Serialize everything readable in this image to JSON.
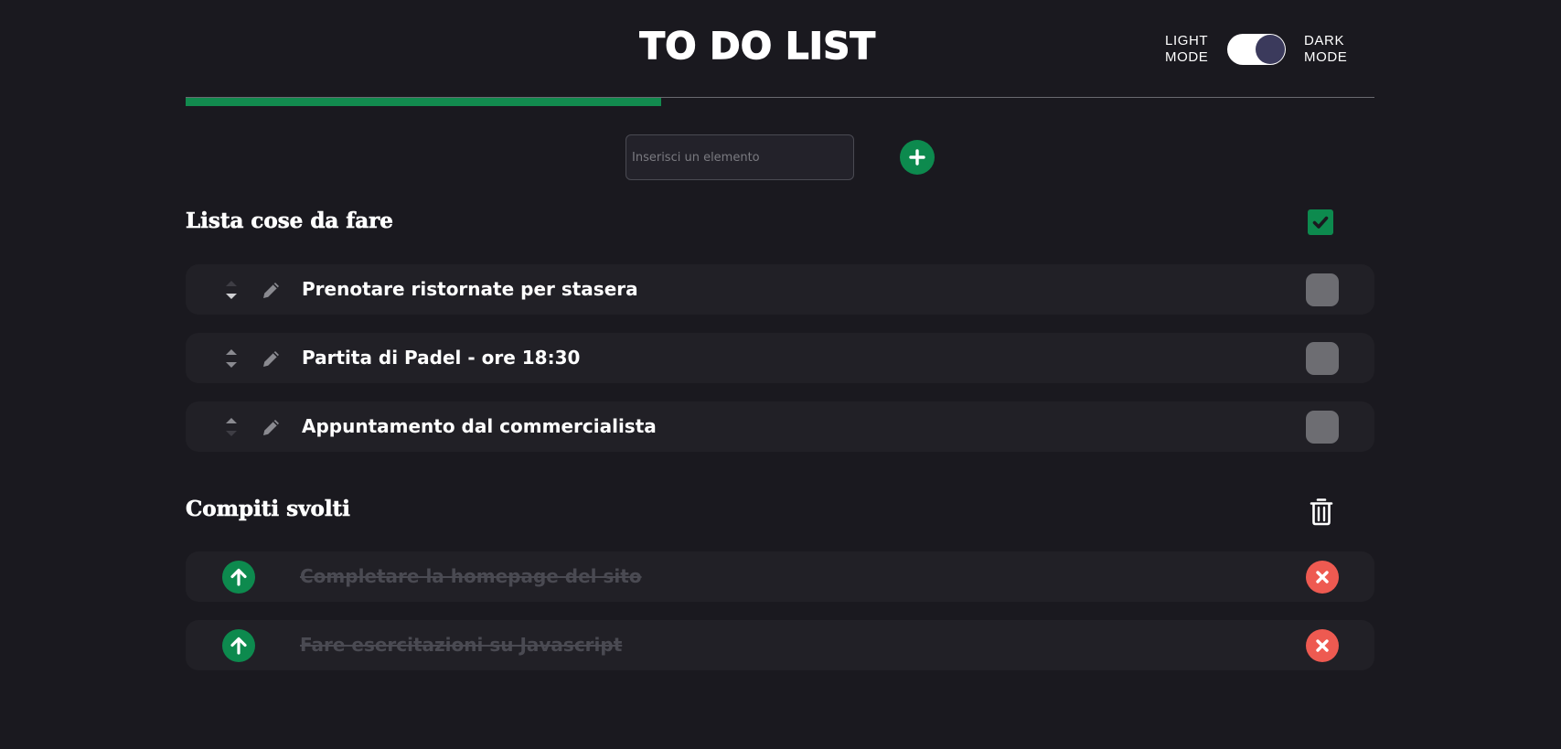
{
  "header": {
    "title": "TO DO LIST",
    "light_mode_label": [
      "LIGHT",
      "MODE"
    ],
    "dark_mode_label": [
      "DARK",
      "MODE"
    ],
    "dark_mode_on": true
  },
  "progress": {
    "fraction": 0.4
  },
  "add_form": {
    "placeholder": "Inserisci un elemento",
    "value": ""
  },
  "todo_section": {
    "title": "Lista cose da fare",
    "items": [
      {
        "label": "Prenotare ristornate per stasera",
        "up_enabled": false,
        "down_enabled": true,
        "checked": false
      },
      {
        "label": "Partita di Padel - ore 18:30",
        "up_enabled": true,
        "down_enabled": true,
        "checked": false
      },
      {
        "label": "Appuntamento dal commercialista",
        "up_enabled": true,
        "down_enabled": false,
        "checked": false
      }
    ]
  },
  "done_section": {
    "title": "Compiti svolti",
    "items": [
      {
        "label": "Completare la homepage del sito"
      },
      {
        "label": "Fare esercitazioni su Javascript"
      }
    ]
  },
  "colors": {
    "background": "#1a191f",
    "item_background": "#212026",
    "accent_green": "#0d8a4e",
    "remove_red": "#ee5a51",
    "checkbox_gray": "#6d6d72"
  },
  "icons": {
    "add": "plus-icon",
    "check_all": "check-icon",
    "edit": "pencil-icon",
    "sort": "sort-arrows-icon",
    "clear": "trash-icon",
    "restore": "arrow-up-icon",
    "remove": "x-icon"
  }
}
